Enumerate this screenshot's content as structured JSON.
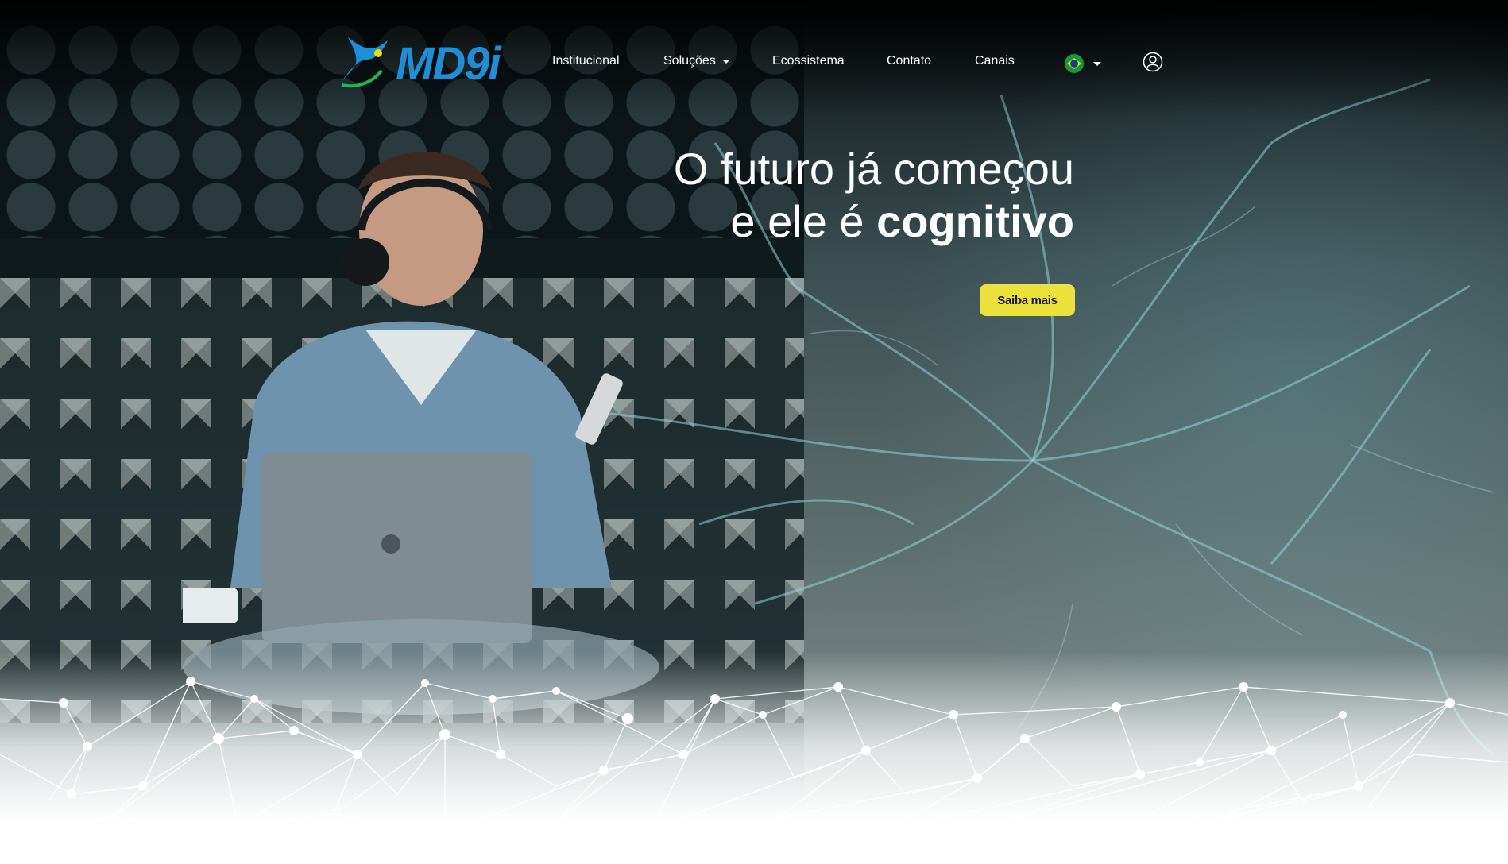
{
  "nav": {
    "logo_text": "MD9i",
    "items": [
      {
        "label": "Institucional",
        "has_dropdown": false
      },
      {
        "label": "Soluções",
        "has_dropdown": true
      },
      {
        "label": "Ecossistema",
        "has_dropdown": false
      },
      {
        "label": "Contato",
        "has_dropdown": false
      },
      {
        "label": "Canais",
        "has_dropdown": false
      }
    ],
    "language_icon": "brazil-flag-icon",
    "account_icon": "user-circle-icon"
  },
  "hero": {
    "line1": "O futuro já começou",
    "line2_prefix": "e ele é ",
    "line2_bold": "cognitivo",
    "cta_label": "Saiba mais"
  },
  "colors": {
    "accent_yellow": "#ebe13b",
    "logo_blue": "#1e8fd6",
    "logo_accent": "#f5d90a"
  }
}
